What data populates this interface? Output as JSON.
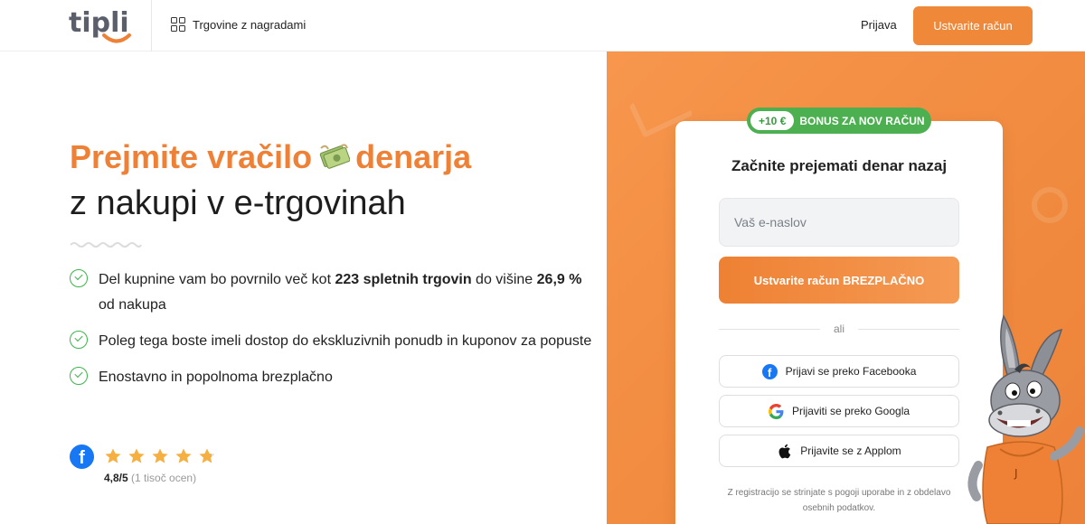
{
  "header": {
    "logo_text": "tipli",
    "stores_label": "Trgovine z nagradami",
    "login_label": "Prijava",
    "signup_label": "Ustvarite račun"
  },
  "hero": {
    "title_line1_a": "Prejmite vračilo",
    "title_line1_b": "denarja",
    "title_line2": "z nakupi v e-trgovinah",
    "benefits": [
      {
        "text_a": "Del kupnine vam bo povrnilo več kot ",
        "bold_a": "223 spletnih trgovin",
        "text_b": " do višine ",
        "bold_b": "26,9 %",
        "text_c": " od nakupa"
      },
      {
        "text": "Poleg tega boste imeli dostop do ekskluzivnih ponudb in kuponov za popuste"
      },
      {
        "text": "Enostavno in popolnoma brezplačno"
      }
    ]
  },
  "rating": {
    "score": "4,8/5",
    "count": "(1 tisoč ocen)",
    "stars_value": 4.8,
    "stars_max": 5
  },
  "signup_card": {
    "bonus_amount": "+10 €",
    "bonus_label": "BONUS ZA NOV RAČUN",
    "title": "Začnite prejemati denar nazaj",
    "email_placeholder": "Vaš e-naslov",
    "register_label": "Ustvarite račun BREZPLAČNO",
    "or_label": "ali",
    "facebook_label": "Prijavi se preko Facebooka",
    "google_label": "Prijaviti se preko Googla",
    "apple_label": "Prijavite se z Applom",
    "terms_text": "Z registracijo se strinjate s pogoji uporabe in z obdelavo osebnih podatkov."
  },
  "colors": {
    "brand_orange": "#f0883a",
    "green": "#4caf50",
    "facebook_blue": "#1877f2"
  },
  "icons": {
    "stores": "grid-icon",
    "money": "money-bills-icon",
    "check": "check-circle-icon",
    "facebook": "facebook-icon",
    "google": "google-icon",
    "apple": "apple-icon",
    "star": "star-icon"
  }
}
